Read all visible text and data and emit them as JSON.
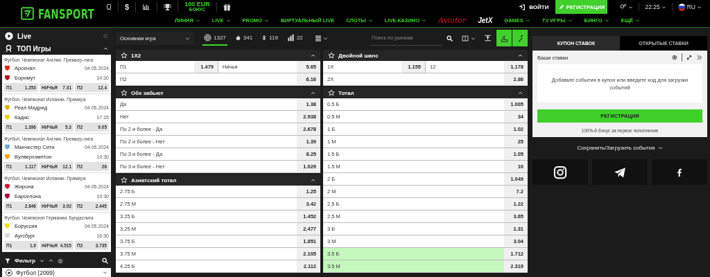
{
  "header": {
    "logo": "FANSPORT",
    "top_icons": [
      {
        "kind": "phone"
      },
      {
        "kind": "currency",
        "text": "$"
      },
      {
        "kind": "stats"
      },
      {
        "kind": "trophy"
      },
      {
        "kind": "bonus",
        "amount": "100 EUR",
        "label": "БОНУС"
      },
      {
        "kind": "gift"
      }
    ],
    "login": "ВОЙТИ",
    "register": "РЕГИСТРАЦИЯ",
    "time": "22:25",
    "language": "RU",
    "nav": [
      {
        "label": "ЛИНИЯ",
        "kind": "menu"
      },
      {
        "label": "LIVE",
        "kind": "menu"
      },
      {
        "label": "PROMO",
        "kind": "menu"
      },
      {
        "label": "ВИРТУАЛЬНЫЙ LIVE",
        "kind": "link"
      },
      {
        "label": "СЛОТЫ",
        "kind": "menu"
      },
      {
        "label": "LIVE-КАЗИНО",
        "kind": "menu"
      },
      {
        "label": "Aviator",
        "kind": "aviator"
      },
      {
        "label": "JetX",
        "kind": "jetx"
      },
      {
        "label": "GAMES",
        "kind": "menu"
      },
      {
        "label": "TV ИГРЫ",
        "kind": "menu"
      },
      {
        "label": "БИНГО",
        "kind": "menu"
      },
      {
        "label": "ЕЩЁ",
        "kind": "menu"
      }
    ]
  },
  "sidebar": {
    "live": "Live",
    "top_title": "ТОП Игры",
    "games": [
      {
        "league": "Футбол. Чемпионат Англии. Премьер-лига",
        "home": {
          "name": "Арсенал",
          "color": "#db2a1f"
        },
        "away": {
          "name": "Борнмут",
          "color": "#b5121b"
        },
        "date": "04.05.2024",
        "time": "14:30",
        "odds": [
          {
            "label": "П1",
            "value": "1.253"
          },
          {
            "label": "НИЧЬЯ",
            "value": "7.31"
          },
          {
            "label": "П2",
            "value": "12.4"
          }
        ]
      },
      {
        "league": "Футбол. Чемпионат Испании. Примера",
        "home": {
          "name": "Реал Мадрид",
          "color": "#e3b400"
        },
        "away": {
          "name": "Кадис",
          "color": "#f2cf00"
        },
        "date": "04.05.2024",
        "time": "17:15",
        "odds": [
          {
            "label": "П1",
            "value": "1.396"
          },
          {
            "label": "НИЧЬЯ",
            "value": "5.3"
          },
          {
            "label": "П2",
            "value": "9.05"
          }
        ]
      },
      {
        "league": "Футбол. Чемпионат Англии. Премьер-лига",
        "home": {
          "name": "Манчестер Сити",
          "color": "#6cabdd"
        },
        "away": {
          "name": "Вулверхэмптон",
          "color": "#f5a800"
        },
        "date": "04.05.2024",
        "time": "19:30",
        "odds": [
          {
            "label": "П1",
            "value": "1.117"
          },
          {
            "label": "НИЧЬЯ",
            "value": "12.1"
          },
          {
            "label": "П2",
            "value": "26"
          }
        ]
      },
      {
        "league": "Футбол. Чемпионат Испании. Примера",
        "home": {
          "name": "Жирона",
          "color": "#d8102a"
        },
        "away": {
          "name": "Барселона",
          "color": "#a50044"
        },
        "date": "04.05.2024",
        "time": "19:30",
        "odds": [
          {
            "label": "П1",
            "value": "2.846"
          },
          {
            "label": "НИЧЬЯ",
            "value": "3.92"
          },
          {
            "label": "П2",
            "value": "2.445"
          }
        ]
      },
      {
        "league": "Футбол. Чемпионат Германии. Бундеслига",
        "home": {
          "name": "Боруссия",
          "color": "#f5d800"
        },
        "away": {
          "name": "Аугсбург",
          "color": "#d8d8d8"
        },
        "date": "04.05.2024",
        "time": "16:30",
        "odds": [
          {
            "label": "П1",
            "value": "1.9"
          },
          {
            "label": "НИЧЬЯ",
            "value": "4.515"
          },
          {
            "label": "П2",
            "value": "3.735"
          }
        ]
      }
    ],
    "filter": "Фильтр",
    "sport": "Футбол (2099)"
  },
  "toolbar": {
    "game_select": "Основная игра",
    "counters": [
      {
        "kind": "live",
        "count": "1327",
        "selected": true
      },
      {
        "kind": "fire",
        "count": "341",
        "selected": false
      },
      {
        "kind": "updown",
        "count": "119",
        "selected": false
      },
      {
        "kind": "bars",
        "count": "22",
        "selected": false
      }
    ],
    "search": {
      "placeholder": "Поиск по рынкам"
    }
  },
  "markets": [
    {
      "title": "1X2",
      "rows": [
        {
          "cells": [
            {
              "label": "П1",
              "odd": "1.479"
            },
            {
              "label": "Ничья",
              "odd": "5.65"
            }
          ]
        },
        {
          "cells": [
            {
              "label": "П2",
              "odd": "6.16"
            }
          ]
        }
      ]
    },
    {
      "title": "Обе забьют",
      "rows": [
        {
          "cells": [
            {
              "label": "Да",
              "odd": "1.38"
            }
          ]
        },
        {
          "cells": [
            {
              "label": "Нет",
              "odd": "2.938"
            }
          ]
        },
        {
          "cells": [
            {
              "label": "По 2 и более - Да",
              "odd": "2.678"
            }
          ]
        },
        {
          "cells": [
            {
              "label": "По 2 и более - Нет",
              "odd": "1.39"
            }
          ]
        },
        {
          "cells": [
            {
              "label": "По 3 и более - Да",
              "odd": "8.25"
            }
          ]
        },
        {
          "cells": [
            {
              "label": "По 3 и более - Нет",
              "odd": "1.029"
            }
          ]
        }
      ]
    },
    {
      "title": "Азиатский тотал",
      "rows": [
        {
          "cells": [
            {
              "label": "2.75 Б",
              "odd": "1.25"
            }
          ]
        },
        {
          "cells": [
            {
              "label": "2.75 М",
              "odd": "3.42"
            }
          ]
        },
        {
          "cells": [
            {
              "label": "3.25 Б",
              "odd": "1.452"
            }
          ]
        },
        {
          "cells": [
            {
              "label": "3.25 М",
              "odd": "2.477"
            }
          ]
        },
        {
          "cells": [
            {
              "label": "3.75 Б",
              "odd": "1.851"
            }
          ]
        },
        {
          "cells": [
            {
              "label": "3.75 М",
              "odd": "2.105"
            }
          ]
        },
        {
          "cells": [
            {
              "label": "4.25 Б",
              "odd": "2.112"
            }
          ]
        }
      ]
    },
    {
      "title": "Двойной шанс",
      "rows": [
        {
          "cells": [
            {
              "label": "1X",
              "odd": "1.155"
            },
            {
              "label": "12",
              "odd": "1.178"
            }
          ]
        },
        {
          "cells": [
            {
              "label": "2X",
              "odd": "2.86"
            }
          ]
        }
      ]
    },
    {
      "title": "Тотал",
      "rows": [
        {
          "cells": [
            {
              "label": "0.5 Б",
              "odd": "1.005"
            }
          ],
          "highlighted": false
        },
        {
          "cells": [
            {
              "label": "0.5 М",
              "odd": "34"
            }
          ],
          "highlighted": false
        },
        {
          "cells": [
            {
              "label": "1 Б",
              "odd": "1.02"
            }
          ],
          "highlighted": false
        },
        {
          "cells": [
            {
              "label": "1 М",
              "odd": "25"
            }
          ],
          "highlighted": false
        },
        {
          "cells": [
            {
              "label": "1.5 Б",
              "odd": "1.05"
            }
          ],
          "highlighted": false
        },
        {
          "cells": [
            {
              "label": "1.5 М",
              "odd": "10"
            }
          ],
          "highlighted": false
        },
        {
          "cells": [
            {
              "label": "2 Б",
              "odd": "1.049"
            }
          ],
          "highlighted": false
        },
        {
          "cells": [
            {
              "label": "2 М",
              "odd": "7.2"
            }
          ],
          "highlighted": false
        },
        {
          "cells": [
            {
              "label": "2.5 Б",
              "odd": "1.22"
            }
          ],
          "highlighted": false
        },
        {
          "cells": [
            {
              "label": "2.5 М",
              "odd": "3.65"
            }
          ],
          "highlighted": false
        },
        {
          "cells": [
            {
              "label": "3 Б",
              "odd": "1.31"
            }
          ],
          "highlighted": false
        },
        {
          "cells": [
            {
              "label": "3 М",
              "odd": "3.04"
            }
          ],
          "highlighted": false
        },
        {
          "cells": [
            {
              "label": "3.5 Б",
              "odd": "1.712"
            }
          ],
          "highlighted": true
        },
        {
          "cells": [
            {
              "label": "3.5 М",
              "odd": "2.319"
            }
          ],
          "highlighted": true
        }
      ]
    }
  ],
  "coupon": {
    "tabs": [
      {
        "label": "КУПОН СТАВОК",
        "selected": true
      },
      {
        "label": "ОТКРЫТЫЕ СТАВКИ",
        "selected": false
      }
    ],
    "title": "Ваши ставки",
    "message": "Добавьте события в купон или введите код для загрузки событий",
    "register": "РЕГИСТРАЦИЯ",
    "bonus": "100%-й бонус за первое пополнение",
    "save_load": "Сохранить/Загрузить события"
  },
  "social": [
    {
      "kind": "instagram"
    },
    {
      "kind": "telegram"
    },
    {
      "kind": "facebook"
    }
  ]
}
